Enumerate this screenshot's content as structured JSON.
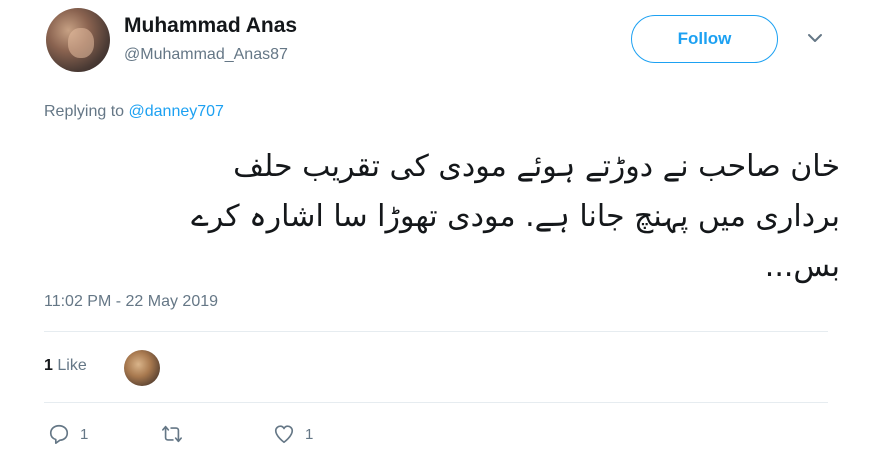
{
  "author": {
    "name": "Muhammad Anas",
    "handle": "@Muhammad_Anas87"
  },
  "follow_label": "Follow",
  "replying": {
    "prefix": "Replying to",
    "mention": "@danney707"
  },
  "tweet": {
    "line1": "خان صاحب نے دوڑتے ہوئے مودی کی تقریب حلف",
    "line2": "برداری میں پہنچ جانا ہے. مودی تھوڑا سا اشارہ کرے",
    "line3": "بس..."
  },
  "timestamp": "11:02 PM - 22 May 2019",
  "likes": {
    "count": "1",
    "label": "Like"
  },
  "actions": {
    "reply_count": "1",
    "retweet_count": "",
    "like_count": "1"
  },
  "colors": {
    "accent": "#1da1f2",
    "muted": "#657786",
    "text": "#14171a",
    "divider": "#e6ecf0"
  },
  "icons": {
    "reply": "reply-icon",
    "retweet": "retweet-icon",
    "like": "heart-icon",
    "menu": "chevron-down-icon"
  }
}
